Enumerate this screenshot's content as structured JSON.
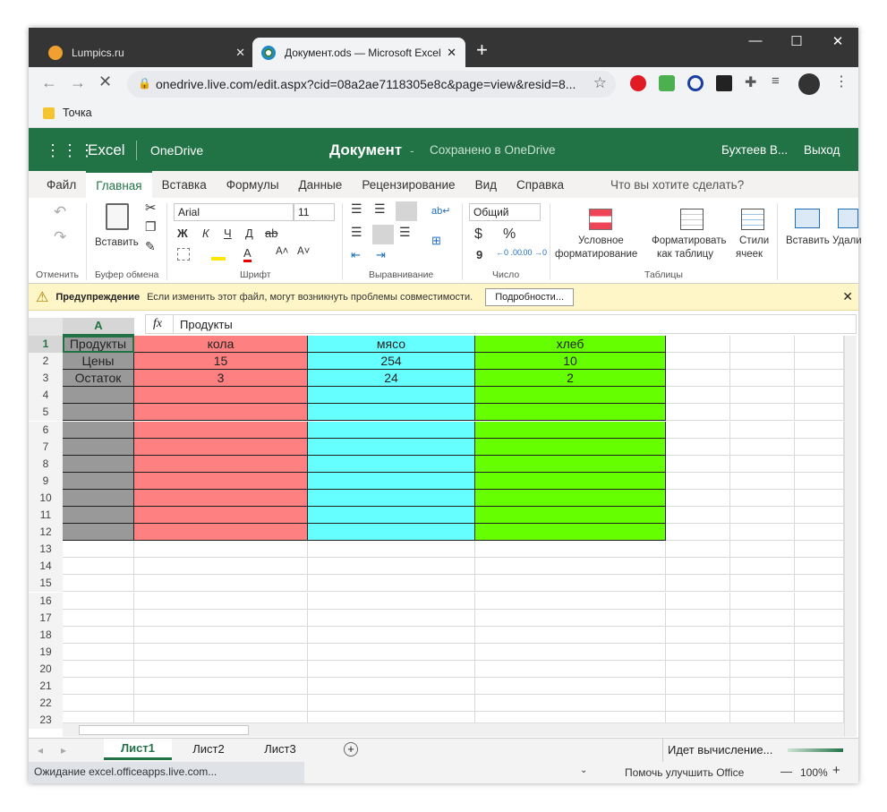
{
  "browser": {
    "tabs": [
      {
        "title": "Lumpics.ru",
        "active": false
      },
      {
        "title": "Документ.ods — Microsoft Excel",
        "active": true
      }
    ],
    "new_tab": "+",
    "url": "onedrive.live.com/edit.aspx?cid=08a2ae7118305e8c&page=view&resid=8...",
    "bookmark": "Точка",
    "window_controls": {
      "minimize": "—",
      "maximize": "☐",
      "close": "✕"
    }
  },
  "excel": {
    "app": "Excel",
    "service": "OneDrive",
    "doc_title": "Документ",
    "dash": "-",
    "saved": "Сохранено в OneDrive",
    "user": "Бухтеев В...",
    "logout": "Выход",
    "menu": [
      "Файл",
      "Главная",
      "Вставка",
      "Формулы",
      "Данные",
      "Рецензирование",
      "Вид",
      "Справка"
    ],
    "menu_active": "Главная",
    "search": "Что вы хотите сделать?",
    "ribbon": {
      "undo_group": "Отменить",
      "paste": "Вставить",
      "clipboard_group": "Буфер обмена",
      "font_name": "Arial",
      "font_size": "11",
      "bold": "Ж",
      "italic": "К",
      "underline": "Ч",
      "dunderline": "Д",
      "strike": "ab",
      "grow": "A˄",
      "shrink": "A˅",
      "font_group": "Шрифт",
      "align_group": "Выравнивание",
      "number_format": "Общий",
      "currency": "$",
      "percent": "%",
      "comma": "9",
      "number_group": "Число",
      "cond_format_1": "Условное",
      "cond_format_2": "форматирование",
      "fmt_table_1": "Форматировать",
      "fmt_table_2": "как таблицу",
      "styles_1": "Стили",
      "styles_2": "ячеек",
      "tables_group": "Таблицы",
      "insert": "Вставить",
      "delete": "Удали"
    },
    "warning": {
      "title": "Предупреждение",
      "text": "Если изменить этот файл, могут возникнуть проблемы совместимости.",
      "button": "Подробности...",
      "close": "✕"
    },
    "formula": {
      "fx": "fx",
      "value": "Продукты"
    },
    "col_a": "A",
    "rows": [
      "1",
      "2",
      "3",
      "4",
      "5",
      "6",
      "7",
      "8",
      "9",
      "10",
      "11",
      "12",
      "13",
      "14",
      "15",
      "16",
      "17",
      "18",
      "19",
      "20",
      "21",
      "22",
      "23"
    ],
    "data": [
      [
        "Продукты",
        "кола",
        "мясо",
        "хлеб"
      ],
      [
        "Цены",
        "15",
        "254",
        "10"
      ],
      [
        "Остаток",
        "3",
        "24",
        "2"
      ]
    ],
    "colors": {
      "a": "#999999",
      "b": "#ff8080",
      "c": "#66ffff",
      "d": "#66ff00",
      "excel_green": "#217346"
    },
    "sheets": [
      "Лист1",
      "Лист2",
      "Лист3"
    ],
    "active_sheet": "Лист1",
    "calc": "Идет вычисление...",
    "status_left": "Ожидание excel.officeapps.live.com...",
    "improve": "Помочь улучшить Office",
    "zoom": "100%",
    "zoom_minus": "—",
    "zoom_plus": "+"
  }
}
